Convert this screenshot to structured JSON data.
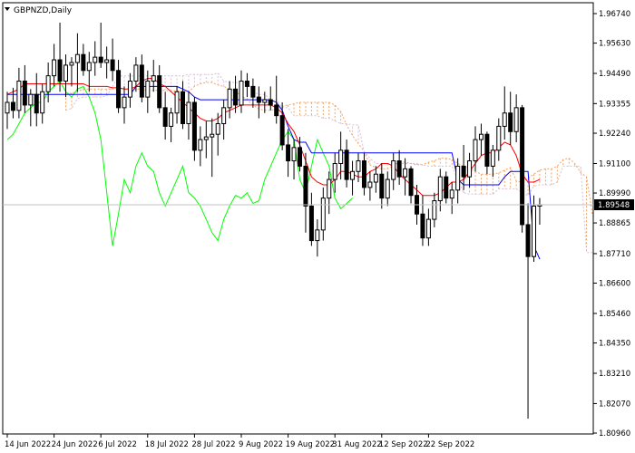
{
  "chart_data": {
    "type": "candlestick",
    "symbol_label": "GBPNZD,Daily",
    "y_ticks": [
      "1.96740",
      "1.95630",
      "1.94490",
      "1.93355",
      "1.92240",
      "1.91100",
      "1.89990",
      "1.88865",
      "1.87710",
      "1.86600",
      "1.85460",
      "1.84350",
      "1.83210",
      "1.82070",
      "1.80960"
    ],
    "x_ticks": [
      "14 Jun 2022",
      "24 Jun 2022",
      "6 Jul 2022",
      "18 Jul 2022",
      "28 Jul 2022",
      "9 Aug 2022",
      "19 Aug 2022",
      "31 Aug 2022",
      "12 Sep 2022",
      "22 Sep 2022"
    ],
    "ylim": [
      1.8096,
      1.9674
    ],
    "current_price": "1.89548",
    "colors": {
      "bull": "#ffffff",
      "bear": "#000000",
      "wick": "#000000",
      "tenkan": "#ff0000",
      "kijun": "#0000ff",
      "chikou": "#00ff00",
      "cloud_a": "#f4a460",
      "cloud_b": "#d8bfd8",
      "grid": "#c0c0c0",
      "axis": "#000000"
    },
    "candles": [
      [
        1.93,
        1.938,
        1.924,
        1.934
      ],
      [
        1.934,
        1.9395,
        1.928,
        1.931
      ],
      [
        1.931,
        1.947,
        1.928,
        1.942
      ],
      [
        1.942,
        1.948,
        1.93,
        1.933
      ],
      [
        1.933,
        1.939,
        1.925,
        1.937
      ],
      [
        1.937,
        1.945,
        1.925,
        1.93
      ],
      [
        1.93,
        1.941,
        1.926,
        1.938
      ],
      [
        1.938,
        1.949,
        1.934,
        1.944
      ],
      [
        1.944,
        1.956,
        1.94,
        1.95
      ],
      [
        1.95,
        1.964,
        1.938,
        1.942
      ],
      [
        1.942,
        1.952,
        1.936,
        1.948
      ],
      [
        1.948,
        1.951,
        1.94,
        1.949
      ],
      [
        1.949,
        1.96,
        1.938,
        1.952
      ],
      [
        1.952,
        1.956,
        1.944,
        1.946
      ],
      [
        1.946,
        1.953,
        1.938,
        1.949
      ],
      [
        1.949,
        1.957,
        1.944,
        1.951
      ],
      [
        1.951,
        1.964,
        1.947,
        1.949
      ],
      [
        1.949,
        1.955,
        1.943,
        1.95
      ],
      [
        1.95,
        1.958,
        1.942,
        1.946
      ],
      [
        1.946,
        1.95,
        1.93,
        1.932
      ],
      [
        1.932,
        1.94,
        1.926,
        1.936
      ],
      [
        1.936,
        1.945,
        1.932,
        1.942
      ],
      [
        1.942,
        1.951,
        1.938,
        1.948
      ],
      [
        1.948,
        1.952,
        1.934,
        1.936
      ],
      [
        1.936,
        1.946,
        1.93,
        1.942
      ],
      [
        1.942,
        1.95,
        1.938,
        1.944
      ],
      [
        1.944,
        1.948,
        1.93,
        1.932
      ],
      [
        1.932,
        1.938,
        1.92,
        1.925
      ],
      [
        1.925,
        1.932,
        1.919,
        1.93
      ],
      [
        1.93,
        1.94,
        1.926,
        1.938
      ],
      [
        1.938,
        1.942,
        1.924,
        1.926
      ],
      [
        1.926,
        1.938,
        1.92,
        1.934
      ],
      [
        1.934,
        1.936,
        1.912,
        1.916
      ],
      [
        1.916,
        1.925,
        1.91,
        1.92
      ],
      [
        1.92,
        1.927,
        1.913,
        1.921
      ],
      [
        1.921,
        1.928,
        1.906,
        1.922
      ],
      [
        1.922,
        1.93,
        1.914,
        1.926
      ],
      [
        1.926,
        1.935,
        1.92,
        1.932
      ],
      [
        1.932,
        1.942,
        1.928,
        1.939
      ],
      [
        1.939,
        1.944,
        1.93,
        1.933
      ],
      [
        1.933,
        1.946,
        1.93,
        1.942
      ],
      [
        1.942,
        1.945,
        1.936,
        1.94
      ],
      [
        1.94,
        1.943,
        1.932,
        1.936
      ],
      [
        1.936,
        1.94,
        1.928,
        1.934
      ],
      [
        1.934,
        1.938,
        1.93,
        1.935
      ],
      [
        1.935,
        1.94,
        1.931,
        1.933
      ],
      [
        1.933,
        1.944,
        1.926,
        1.929
      ],
      [
        1.929,
        1.934,
        1.916,
        1.918
      ],
      [
        1.918,
        1.924,
        1.906,
        1.912
      ],
      [
        1.912,
        1.92,
        1.905,
        1.917
      ],
      [
        1.917,
        1.921,
        1.908,
        1.91
      ],
      [
        1.91,
        1.915,
        1.885,
        1.895
      ],
      [
        1.895,
        1.9,
        1.88,
        1.882
      ],
      [
        1.882,
        1.89,
        1.876,
        1.886
      ],
      [
        1.886,
        1.902,
        1.882,
        1.898
      ],
      [
        1.898,
        1.908,
        1.892,
        1.905
      ],
      [
        1.905,
        1.915,
        1.9,
        1.911
      ],
      [
        1.911,
        1.923,
        1.905,
        1.916
      ],
      [
        1.916,
        1.92,
        1.902,
        1.905
      ],
      [
        1.905,
        1.912,
        1.899,
        1.908
      ],
      [
        1.908,
        1.915,
        1.904,
        1.912
      ],
      [
        1.912,
        1.915,
        1.899,
        1.902
      ],
      [
        1.902,
        1.908,
        1.897,
        1.904
      ],
      [
        1.904,
        1.91,
        1.9,
        1.907
      ],
      [
        1.907,
        1.911,
        1.894,
        1.898
      ],
      [
        1.898,
        1.908,
        1.895,
        1.905
      ],
      [
        1.905,
        1.915,
        1.901,
        1.912
      ],
      [
        1.912,
        1.916,
        1.903,
        1.906
      ],
      [
        1.906,
        1.913,
        1.899,
        1.909
      ],
      [
        1.909,
        1.91,
        1.896,
        1.899
      ],
      [
        1.899,
        1.903,
        1.888,
        1.892
      ],
      [
        1.892,
        1.899,
        1.88,
        1.883
      ],
      [
        1.883,
        1.894,
        1.88,
        1.89
      ],
      [
        1.89,
        1.9,
        1.887,
        1.897
      ],
      [
        1.897,
        1.909,
        1.893,
        1.906
      ],
      [
        1.906,
        1.908,
        1.896,
        1.898
      ],
      [
        1.898,
        1.904,
        1.892,
        1.901
      ],
      [
        1.901,
        1.913,
        1.896,
        1.91
      ],
      [
        1.91,
        1.918,
        1.901,
        1.906
      ],
      [
        1.906,
        1.915,
        1.902,
        1.912
      ],
      [
        1.912,
        1.925,
        1.908,
        1.92
      ],
      [
        1.92,
        1.926,
        1.914,
        1.922
      ],
      [
        1.922,
        1.923,
        1.907,
        1.91
      ],
      [
        1.91,
        1.918,
        1.906,
        1.916
      ],
      [
        1.916,
        1.928,
        1.912,
        1.925
      ],
      [
        1.925,
        1.94,
        1.92,
        1.93
      ],
      [
        1.93,
        1.938,
        1.918,
        1.923
      ],
      [
        1.923,
        1.937,
        1.919,
        1.932
      ],
      [
        1.932,
        1.933,
        1.885,
        1.888
      ],
      [
        1.888,
        1.896,
        1.815,
        1.876
      ],
      [
        1.876,
        1.899,
        1.874,
        1.895
      ],
      [
        1.895,
        1.898,
        1.888,
        1.8955
      ]
    ],
    "tenkan": [
      1.937,
      1.938,
      1.939,
      1.941,
      1.941,
      1.941,
      1.941,
      1.941,
      1.941,
      1.941,
      1.941,
      1.941,
      1.941,
      1.941,
      1.94,
      1.94,
      1.94,
      1.94,
      1.9395,
      1.9395,
      1.939,
      1.939,
      1.94,
      1.942,
      1.943,
      1.943,
      1.941,
      1.94,
      1.938,
      1.936,
      1.934,
      1.932,
      1.93,
      1.928,
      1.927,
      1.927,
      1.928,
      1.93,
      1.931,
      1.932,
      1.933,
      1.933,
      1.933,
      1.933,
      1.933,
      1.933,
      1.932,
      1.93,
      1.926,
      1.923,
      1.918,
      1.912,
      1.906,
      1.904,
      1.903,
      1.903,
      1.905,
      1.908,
      1.908,
      1.907,
      1.906,
      1.906,
      1.908,
      1.909,
      1.911,
      1.911,
      1.91,
      1.907,
      1.905,
      1.903,
      1.901,
      1.899,
      1.899,
      1.899,
      1.9,
      1.902,
      1.904,
      1.904,
      1.905,
      1.908,
      1.911,
      1.914,
      1.915,
      1.915,
      1.917,
      1.919,
      1.918,
      1.914,
      1.907,
      1.904,
      1.904,
      1.905
    ],
    "kijun": [
      1.937,
      1.937,
      1.937,
      1.937,
      1.937,
      1.937,
      1.937,
      1.937,
      1.937,
      1.937,
      1.937,
      1.937,
      1.937,
      1.937,
      1.937,
      1.937,
      1.937,
      1.937,
      1.937,
      1.937,
      1.937,
      1.937,
      1.94,
      1.94,
      1.94,
      1.94,
      1.94,
      1.94,
      1.94,
      1.94,
      1.939,
      1.938,
      1.936,
      1.935,
      1.935,
      1.935,
      1.935,
      1.935,
      1.935,
      1.935,
      1.935,
      1.935,
      1.935,
      1.935,
      1.935,
      1.935,
      1.934,
      1.931,
      1.925,
      1.92,
      1.919,
      1.919,
      1.915,
      1.915,
      1.915,
      1.915,
      1.915,
      1.915,
      1.915,
      1.915,
      1.915,
      1.915,
      1.915,
      1.915,
      1.915,
      1.915,
      1.915,
      1.915,
      1.915,
      1.915,
      1.915,
      1.915,
      1.915,
      1.915,
      1.915,
      1.915,
      1.915,
      1.905,
      1.903,
      1.903,
      1.903,
      1.903,
      1.903,
      1.903,
      1.903,
      1.906,
      1.908,
      1.908,
      1.908,
      1.908,
      1.88,
      1.875
    ],
    "chikou": [
      1.92,
      1.922,
      1.926,
      1.93,
      1.932,
      1.934,
      1.934,
      1.938,
      1.94,
      1.942,
      1.938,
      1.936,
      1.939,
      1.94,
      1.936,
      1.93,
      1.92,
      1.9,
      1.88,
      1.892,
      1.905,
      1.9,
      1.91,
      1.915,
      1.91,
      1.908,
      1.9,
      1.895,
      1.9,
      1.905,
      1.91,
      1.9,
      1.898,
      1.895,
      1.89,
      1.885,
      1.882,
      1.89,
      1.895,
      1.899,
      1.898,
      1.9,
      1.896,
      1.897,
      1.905,
      1.91,
      1.915,
      1.92,
      1.923,
      1.92,
      1.905,
      1.9,
      1.91,
      1.92,
      1.915,
      1.91,
      1.898,
      1.894,
      1.896,
      1.898
    ]
  }
}
